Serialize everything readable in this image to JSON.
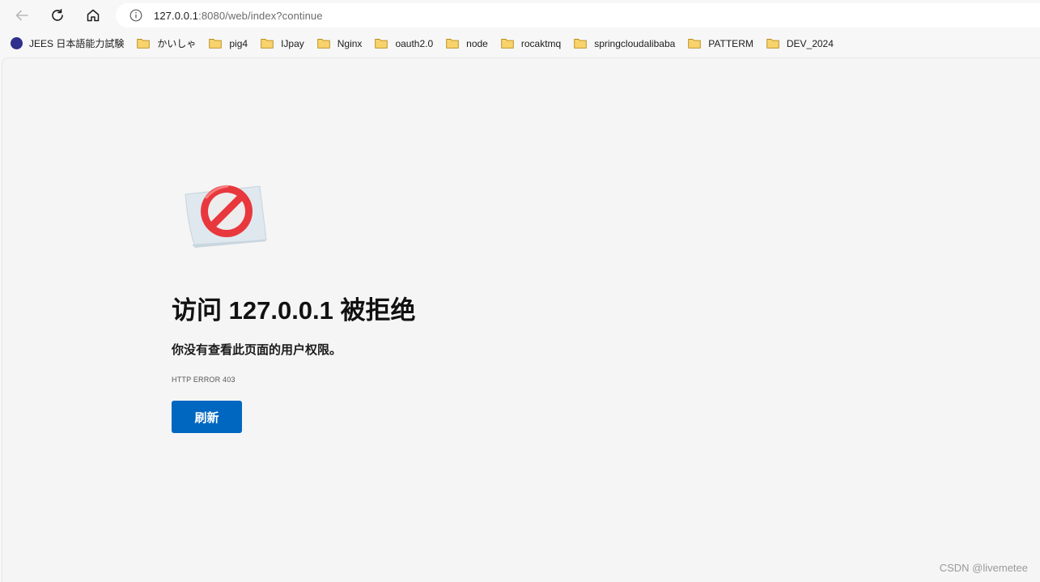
{
  "browser": {
    "nav": {
      "back_icon": "arrow-left-icon",
      "reload_icon": "reload-icon",
      "home_icon": "home-icon"
    },
    "address": {
      "host": "127.0.0.1",
      "rest": ":8080/web/index?continue"
    }
  },
  "bookmarks": [
    {
      "label": "JEES 日本語能力試験",
      "icon": "site-icon"
    },
    {
      "label": "かいしゃ",
      "icon": "folder-icon"
    },
    {
      "label": "pig4",
      "icon": "folder-icon"
    },
    {
      "label": "IJpay",
      "icon": "folder-icon"
    },
    {
      "label": "Nginx",
      "icon": "folder-icon"
    },
    {
      "label": "oauth2.0",
      "icon": "folder-icon"
    },
    {
      "label": "node",
      "icon": "folder-icon"
    },
    {
      "label": "rocaktmq",
      "icon": "folder-icon"
    },
    {
      "label": "springcloudalibaba",
      "icon": "folder-icon"
    },
    {
      "label": "PATTERM",
      "icon": "folder-icon"
    },
    {
      "label": "DEV_2024",
      "icon": "folder-icon"
    }
  ],
  "error_page": {
    "icon": "prohibited-icon",
    "title": "访问 127.0.0.1 被拒绝",
    "subtitle": "你没有查看此页面的用户权限。",
    "error_code": "HTTP ERROR 403",
    "refresh_label": "刷新"
  },
  "watermark": "CSDN @livemetee",
  "colors": {
    "accent": "#0067c0",
    "folder": "#f8d36b",
    "prohibited": "#e8383d"
  }
}
